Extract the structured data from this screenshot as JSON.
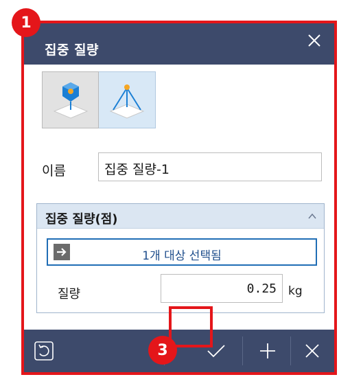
{
  "dialog": {
    "title": "집중 질량",
    "close_icon": "close-icon",
    "type_buttons": [
      {
        "icon": "point-mass-icon",
        "state": "pressed"
      },
      {
        "icon": "distributed-mass-icon",
        "state": "selected"
      }
    ],
    "name": {
      "label": "이름",
      "value": "집중 질량-1"
    },
    "section": {
      "title": "집중 질량(점)",
      "collapse_icon": "chevron-up-icon",
      "selection_text": "1개 대상 선택됨",
      "selection_icon": "arrow-right-icon",
      "mass_label": "질량",
      "mass_value": "0.25",
      "mass_unit": "kg"
    },
    "footer": {
      "reset_icon": "reset-icon",
      "ok_icon": "checkmark-icon",
      "add_icon": "plus-icon",
      "cancel_icon": "close-icon"
    }
  },
  "annotations": {
    "badge_1": "1",
    "badge_3": "3"
  },
  "colors": {
    "title_bar": "#3d4a6b",
    "highlight": "#e4161a",
    "selector_border": "#1f6db5",
    "section_header": "#dbe6f2"
  }
}
